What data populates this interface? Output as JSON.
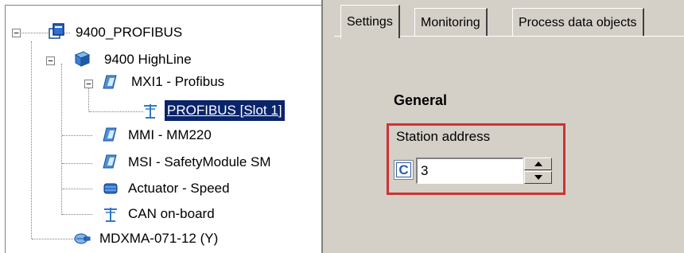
{
  "tree": {
    "items": [
      {
        "label": "9400_PROFIBUS",
        "expander": "−",
        "icon": "project-icon"
      },
      {
        "label": "9400 HighLine",
        "expander": "−",
        "icon": "controller-icon"
      },
      {
        "label": "MXI1 - Profibus",
        "expander": "−",
        "icon": "module-icon"
      },
      {
        "label": "PROFIBUS [Slot 1]",
        "icon": "bus-icon",
        "selected": true
      },
      {
        "label": "MMI - MM220",
        "icon": "module-icon"
      },
      {
        "label": "MSI - SafetyModule SM",
        "icon": "module-icon"
      },
      {
        "label": "Actuator - Speed",
        "icon": "actuator-icon"
      },
      {
        "label": "CAN on-board",
        "icon": "bus-icon"
      },
      {
        "label": "MDXMA-071-12 (Y)",
        "icon": "motor-icon"
      }
    ]
  },
  "tabs": [
    {
      "label": "Settings",
      "active": true
    },
    {
      "label": "Monitoring"
    },
    {
      "label": "Process data objects"
    }
  ],
  "settings": {
    "group_title": "General",
    "station_label": "Station address",
    "badge": "C",
    "station_value": "3"
  },
  "colors": {
    "selection": "#0a246a",
    "highlight_border": "#cc3333",
    "badge": "#2a5db0",
    "window_bg": "#d4d0c8"
  }
}
